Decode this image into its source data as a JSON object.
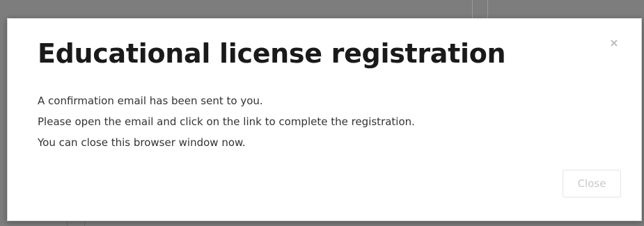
{
  "dialog": {
    "title": "Educational license registration",
    "close_icon": "×",
    "close_icon_name": "close-icon",
    "messages": [
      "A confirmation email has been sent to you.",
      "Please open the email and click on the link to complete the registration.",
      "You can close this browser window now."
    ],
    "close_button_label": "Close"
  },
  "colors": {
    "overlay": "#7d7d7d",
    "dialog_background": "#ffffff",
    "title_text": "#1a1a1a",
    "body_text": "#333333",
    "muted_button_text": "#c8c8c8"
  }
}
